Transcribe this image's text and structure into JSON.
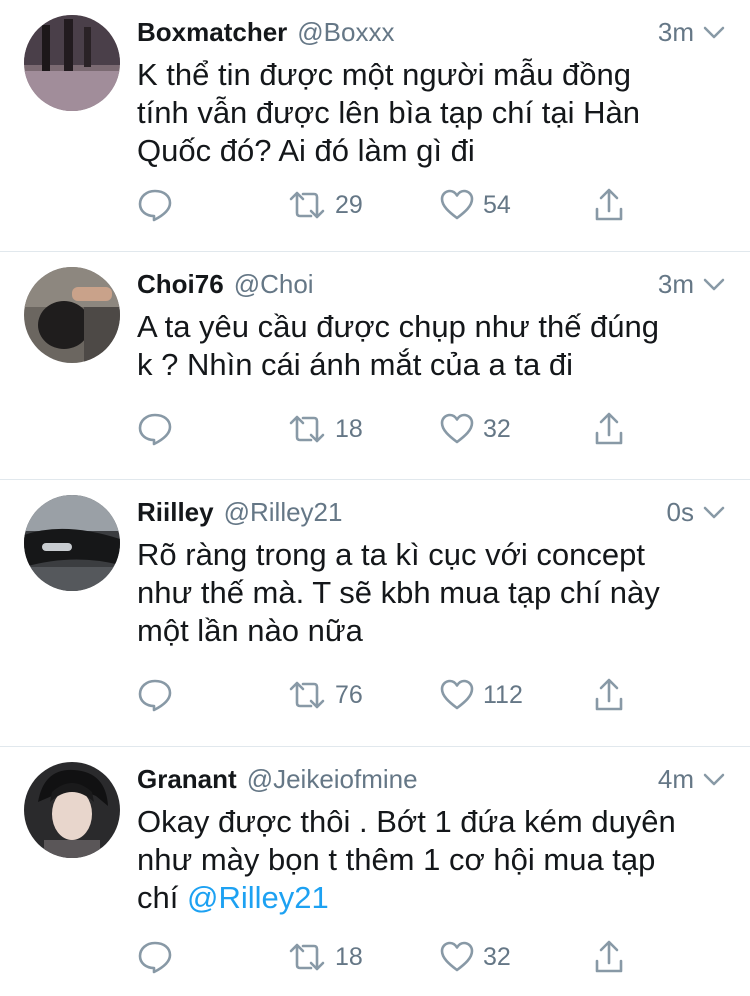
{
  "tweets": [
    {
      "name": "Boxmatcher",
      "handle": "@Boxxx",
      "time": "3m",
      "lines": [
        "K thể tin được một người mẫu đồng",
        "tính vẫn được lên bìa tạp chí tại Hàn",
        "Quốc đó? Ai đó làm gì đi"
      ],
      "retweets": "29",
      "likes": "54"
    },
    {
      "name": "Choi76",
      "handle": "@Choi",
      "time": "3m",
      "lines": [
        "A ta yêu cầu được chụp như thế đúng",
        "k ? Nhìn cái ánh mắt của a ta đi"
      ],
      "retweets": "18",
      "likes": "32"
    },
    {
      "name": "Riilley",
      "handle": "@Rilley21",
      "time": "0s",
      "lines": [
        "Rõ ràng trong a ta kì cục với concept",
        "như thế mà. T sẽ kbh mua tạp chí này",
        "một lần nào nữa"
      ],
      "retweets": "76",
      "likes": "112"
    },
    {
      "name": "Granant",
      "handle": "@Jeikeiofmine",
      "time": "4m",
      "lines": [
        "Okay được thôi . Bớt 1 đứa kém duyên",
        "như mày bọn t thêm 1 cơ hội mua tạp",
        "chí "
      ],
      "mention": "@Rilley21",
      "retweets": "18",
      "likes": "32"
    }
  ],
  "colors": {
    "text": "#14171a",
    "secondary": "#657786",
    "link": "#1da1f2",
    "divider": "#e1e8ed"
  },
  "icons": [
    "reply-icon",
    "retweet-icon",
    "like-icon",
    "share-icon",
    "chevron-down-icon"
  ]
}
